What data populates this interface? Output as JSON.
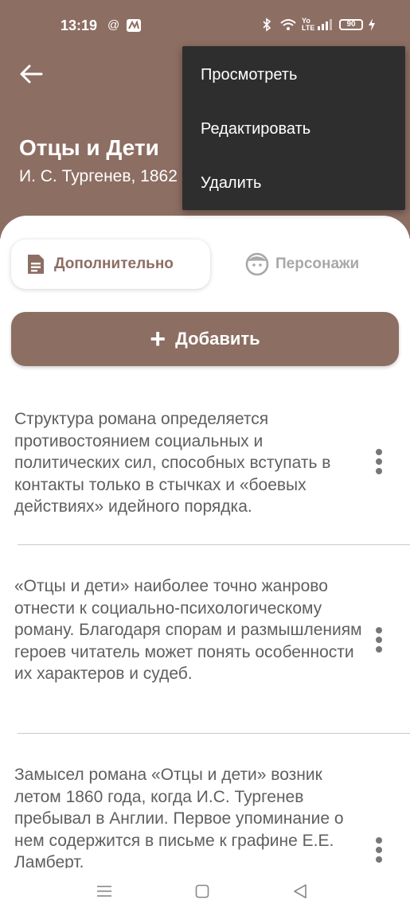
{
  "status_bar": {
    "time": "13:19",
    "battery": "90"
  },
  "book": {
    "title": "Отцы и Дети",
    "author": "И. С. Тургенев, 1862"
  },
  "menu": {
    "items": [
      "Просмотреть",
      "Редактировать",
      "Удалить"
    ]
  },
  "tabs": [
    {
      "label": "Дополнительно",
      "icon": "document-icon",
      "active": true
    },
    {
      "label": "Персонажи",
      "icon": "face-icon",
      "active": false
    }
  ],
  "add_button": {
    "label": "Добавить"
  },
  "notes": [
    {
      "text": "Структура романа определяется противостоянием социальных и политических сил, способных вступать в контакты только в стычках и «боевых действиях» идейного порядка."
    },
    {
      "text": "«Отцы и дети» наиболее точно жанрово отнести к социально-психологическому роману. Благодаря спорам и размышлениям героев читатель может понять особенности их характеров и судеб."
    },
    {
      "text": "Замысел романа «Отцы и дети» возник летом 1860 года, когда И.С. Тургенев пребывал в Англии. Первое упоминание о нем содержится в письме к графине Е.Е. Ламберт."
    }
  ],
  "colors": {
    "accent": "#8d6e63",
    "menu_bg": "#2e2e2e",
    "text": "#5f5f5f",
    "inactive_tab": "#a8a8a8"
  }
}
